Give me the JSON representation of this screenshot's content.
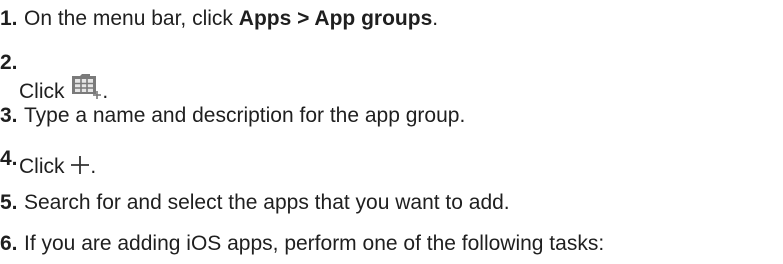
{
  "steps": [
    {
      "number": "1.",
      "text_before": "On the menu bar, click ",
      "bold_text": "Apps > App groups",
      "text_after": "."
    },
    {
      "number": "2.",
      "text_before": "Click ",
      "icon": "add-app-group-icon",
      "text_after": "."
    },
    {
      "number": "3.",
      "text": "Type a name and description for the app group."
    },
    {
      "number": "4.",
      "text_before": "Click ",
      "icon": "plus-icon",
      "text_after": "."
    },
    {
      "number": "5.",
      "text": "Search for and select the apps that you want to add."
    },
    {
      "number": "6.",
      "text": "If you are adding iOS apps, perform one of the following tasks:"
    }
  ]
}
